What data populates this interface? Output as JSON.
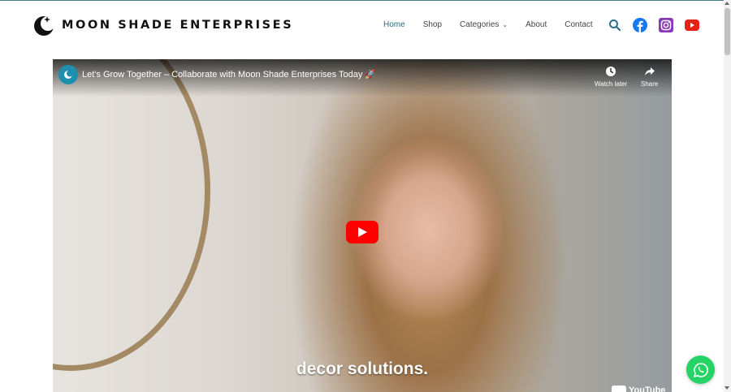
{
  "header": {
    "logo_text": "MOON SHADE ENTERPRISES",
    "nav": [
      {
        "label": "Home",
        "active": true
      },
      {
        "label": "Shop"
      },
      {
        "label": "Categories",
        "has_dropdown": true
      },
      {
        "label": "About"
      },
      {
        "label": "Contact"
      }
    ],
    "social_icons": [
      "search-icon",
      "facebook-icon",
      "instagram-icon",
      "youtube-icon"
    ]
  },
  "video": {
    "title": "Let's Grow Together – Collaborate with Moon Shade Enterprises Today 🚀",
    "watch_later_label": "Watch later",
    "share_label": "Share",
    "subtitle": "decor solutions.",
    "platform_logo": "YouTube"
  },
  "colors": {
    "accent": "#2a6f86",
    "play_button": "#ff0000",
    "whatsapp": "#25d366",
    "facebook": "#1877f2",
    "instagram": "#8a3ab9",
    "youtube": "#e62117"
  }
}
